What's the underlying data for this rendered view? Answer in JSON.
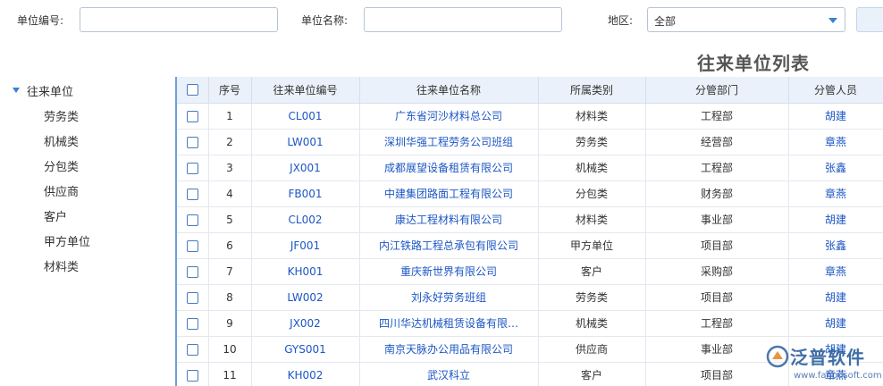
{
  "search": {
    "unit_code_label": "单位编号:",
    "unit_code_value": "",
    "unit_name_label": "单位名称:",
    "unit_name_value": "",
    "region_label": "地区:",
    "region_selected": "全部"
  },
  "list_title": "往来单位列表",
  "tree": {
    "root": "往来单位",
    "children": [
      "劳务类",
      "机械类",
      "分包类",
      "供应商",
      "客户",
      "甲方单位",
      "材料类"
    ]
  },
  "table": {
    "headers": [
      "序号",
      "往来单位编号",
      "往来单位名称",
      "所属类别",
      "分管部门",
      "分管人员"
    ],
    "rows": [
      {
        "seq": "1",
        "code": "CL001",
        "name": "广东省河沙材料总公司",
        "category": "材料类",
        "dept": "工程部",
        "person": "胡建"
      },
      {
        "seq": "2",
        "code": "LW001",
        "name": "深圳华强工程劳务公司班组",
        "category": "劳务类",
        "dept": "经营部",
        "person": "章燕"
      },
      {
        "seq": "3",
        "code": "JX001",
        "name": "成都展望设备租赁有限公司",
        "category": "机械类",
        "dept": "工程部",
        "person": "张鑫"
      },
      {
        "seq": "4",
        "code": "FB001",
        "name": "中建集团路面工程有限公司",
        "category": "分包类",
        "dept": "财务部",
        "person": "章燕"
      },
      {
        "seq": "5",
        "code": "CL002",
        "name": "康达工程材料有限公司",
        "category": "材料类",
        "dept": "事业部",
        "person": "胡建"
      },
      {
        "seq": "6",
        "code": "JF001",
        "name": "内江铁路工程总承包有限公司",
        "category": "甲方单位",
        "dept": "项目部",
        "person": "张鑫"
      },
      {
        "seq": "7",
        "code": "KH001",
        "name": "重庆新世界有限公司",
        "category": "客户",
        "dept": "采购部",
        "person": "章燕"
      },
      {
        "seq": "8",
        "code": "LW002",
        "name": "刘永好劳务班组",
        "category": "劳务类",
        "dept": "项目部",
        "person": "胡建"
      },
      {
        "seq": "9",
        "code": "JX002",
        "name": "四川华达机械租赁设备有限…",
        "category": "机械类",
        "dept": "工程部",
        "person": "胡建"
      },
      {
        "seq": "10",
        "code": "GYS001",
        "name": "南京天脉办公用品有限公司",
        "category": "供应商",
        "dept": "事业部",
        "person": "胡建"
      },
      {
        "seq": "11",
        "code": "KH002",
        "name": "武汉科立",
        "category": "客户",
        "dept": "项目部",
        "person": "章燕"
      }
    ]
  },
  "watermark": {
    "brand": "泛普软件",
    "url": "www.fanpusoft.com"
  },
  "colors": {
    "link": "#1c56c4",
    "header_bg": "#eaf1fa",
    "accent": "#3c7fd0"
  }
}
